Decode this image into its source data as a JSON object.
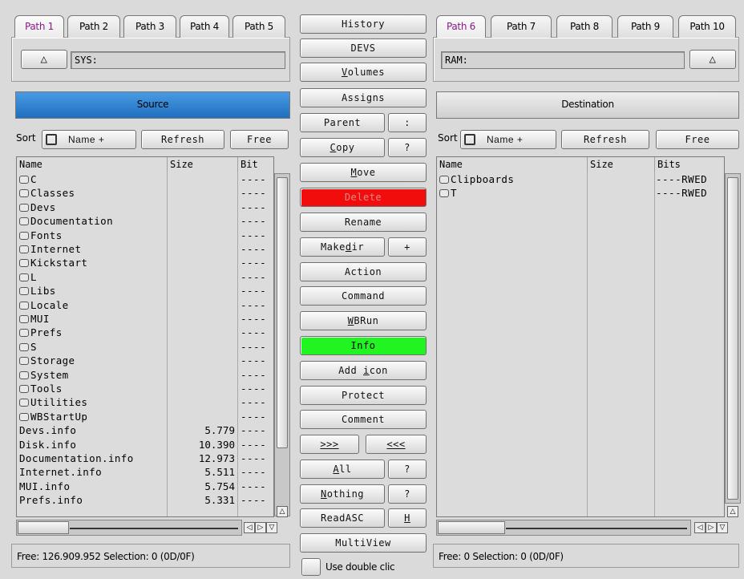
{
  "left": {
    "tabs": [
      "Path 1",
      "Path 2",
      "Path 3",
      "Path 4",
      "Path 5"
    ],
    "path": "SYS:",
    "header": "Source",
    "sort_label": "Sort",
    "sort_value": "Name +",
    "refresh": "Refresh",
    "free": "Free",
    "columns": {
      "name": "Name",
      "size": "Size",
      "bits": "Bit"
    },
    "rows": [
      {
        "name": "C",
        "size": "",
        "bits": "----",
        "dir": true
      },
      {
        "name": "Classes",
        "size": "",
        "bits": "----",
        "dir": true
      },
      {
        "name": "Devs",
        "size": "",
        "bits": "----",
        "dir": true
      },
      {
        "name": "Documentation",
        "size": "",
        "bits": "----",
        "dir": true
      },
      {
        "name": "Fonts",
        "size": "",
        "bits": "----",
        "dir": true
      },
      {
        "name": "Internet",
        "size": "",
        "bits": "----",
        "dir": true
      },
      {
        "name": "Kickstart",
        "size": "",
        "bits": "----",
        "dir": true
      },
      {
        "name": "L",
        "size": "",
        "bits": "----",
        "dir": true
      },
      {
        "name": "Libs",
        "size": "",
        "bits": "----",
        "dir": true
      },
      {
        "name": "Locale",
        "size": "",
        "bits": "----",
        "dir": true
      },
      {
        "name": "MUI",
        "size": "",
        "bits": "----",
        "dir": true
      },
      {
        "name": "Prefs",
        "size": "",
        "bits": "----",
        "dir": true
      },
      {
        "name": "S",
        "size": "",
        "bits": "----",
        "dir": true
      },
      {
        "name": "Storage",
        "size": "",
        "bits": "----",
        "dir": true
      },
      {
        "name": "System",
        "size": "",
        "bits": "----",
        "dir": true
      },
      {
        "name": "Tools",
        "size": "",
        "bits": "----",
        "dir": true
      },
      {
        "name": "Utilities",
        "size": "",
        "bits": "----",
        "dir": true
      },
      {
        "name": "WBStartUp",
        "size": "",
        "bits": "----",
        "dir": true
      },
      {
        "name": "Devs.info",
        "size": "5.779",
        "bits": "----",
        "dir": false
      },
      {
        "name": "Disk.info",
        "size": "10.390",
        "bits": "----",
        "dir": false
      },
      {
        "name": "Documentation.info",
        "size": "12.973",
        "bits": "----",
        "dir": false
      },
      {
        "name": "Internet.info",
        "size": "5.511",
        "bits": "----",
        "dir": false
      },
      {
        "name": "MUI.info",
        "size": "5.754",
        "bits": "----",
        "dir": false
      },
      {
        "name": "Prefs.info",
        "size": "5.331",
        "bits": "----",
        "dir": false
      }
    ],
    "status": "Free: 126.909.952 Selection: 0 (0D/0F)"
  },
  "right": {
    "tabs": [
      "Path 6",
      "Path 7",
      "Path 8",
      "Path 9",
      "Path 10"
    ],
    "path": "RAM:",
    "header": "Destination",
    "sort_label": "Sort",
    "sort_value": "Name +",
    "refresh": "Refresh",
    "free": "Free",
    "columns": {
      "name": "Name",
      "size": "Size",
      "bits": "Bits"
    },
    "rows": [
      {
        "name": "Clipboards",
        "size": "",
        "bits": "----RWED",
        "dir": true
      },
      {
        "name": "T",
        "size": "",
        "bits": "----RWED",
        "dir": true
      }
    ],
    "status": "Free: 0 Selection: 0 (0D/0F)"
  },
  "middle": {
    "history": "History",
    "devs": "DEVS",
    "volumes": "Volumes",
    "assigns": "Assigns",
    "parent": "Parent",
    "colon": ":",
    "copy": "Copy",
    "q1": "?",
    "move": "Move",
    "delete": "Delete",
    "rename": "Rename",
    "makedir": "Makedir",
    "plus": "+",
    "action": "Action",
    "command": "Command",
    "wbrun": "WBRun",
    "info": "Info",
    "addicon": "Add icon",
    "protect": "Protect",
    "comment": "Comment",
    "right_arrow": ">>>",
    "left_arrow": "<<<",
    "all": "All",
    "q2": "?",
    "nothing": "Nothing",
    "q3": "?",
    "readasc": "ReadASC",
    "h": "H",
    "multiview": "MultiView",
    "double_click": "Use double clic"
  },
  "colors": {
    "source_header": "#2a7fd0",
    "delete": "#f20d0d",
    "info": "#21f521",
    "active_tab_text": "#8a1a8a"
  },
  "icons": {
    "up": "up-triangle-icon",
    "sort": "sort-toggle-icon",
    "folder": "drawer-icon"
  }
}
